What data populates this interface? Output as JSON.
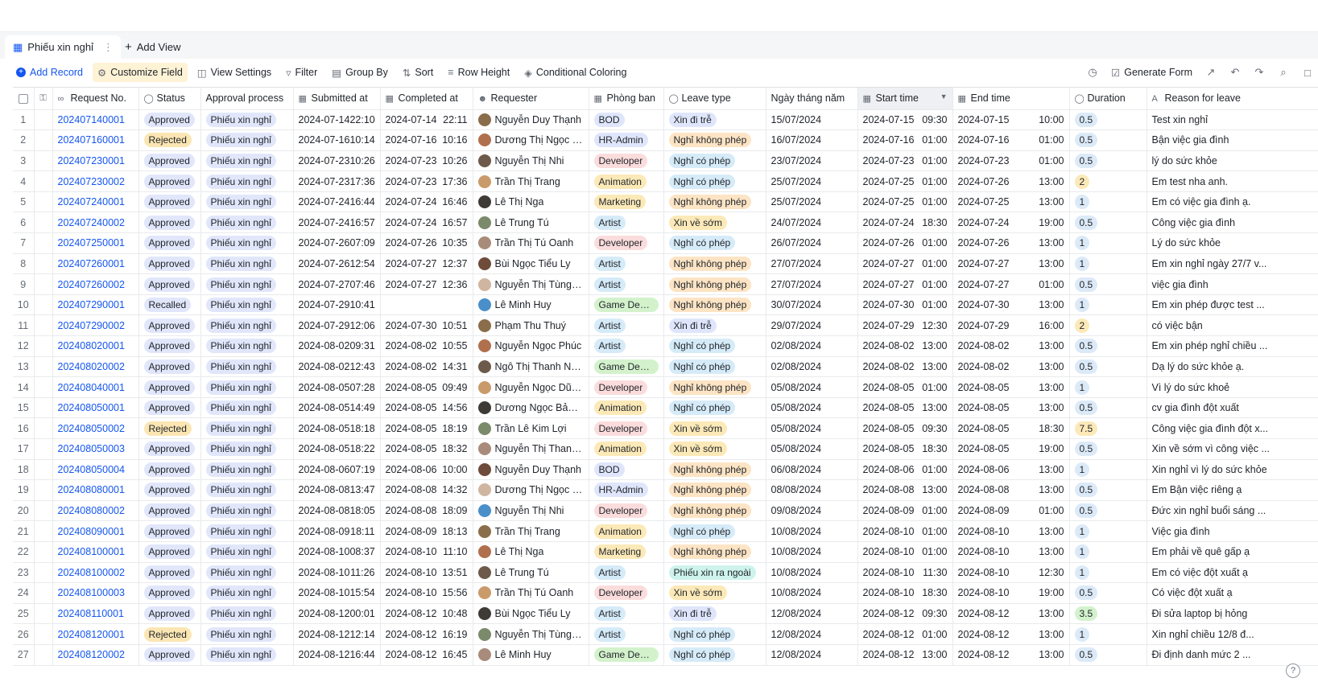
{
  "view": {
    "tab_label": "Phiếu xin nghỉ",
    "add_view_label": "Add View"
  },
  "toolbar": {
    "add_record": "Add Record",
    "customize_field": "Customize Field",
    "view_settings": "View Settings",
    "filter": "Filter",
    "group_by": "Group By",
    "sort": "Sort",
    "row_height": "Row Height",
    "conditional_coloring": "Conditional Coloring",
    "generate_form": "Generate Form"
  },
  "columns": [
    "Request No.",
    "Status",
    "Approval process",
    "Submitted at",
    "Completed at",
    "Requester",
    "Phòng ban",
    "Leave type",
    "Ngày tháng năm",
    "Start time",
    "End time",
    "Duration",
    "Reason for leave"
  ],
  "colors": {
    "accent": "#1456f0",
    "status": {
      "Approved": "#e1e6fa",
      "Rejected": "#fbe6b3",
      "Recalled": "#e1e6fa"
    },
    "dept": {
      "BOD": "#dfe6fb",
      "HR-Admin": "#dfe6fb",
      "Developer": "#fbdcdc",
      "Animation": "#fce9b8",
      "Marketing": "#fce9b8",
      "Artist": "#d6ebf8",
      "Game Desi...": "#d3f2cc"
    },
    "leave": {
      "Xin đi trễ": "#dfe6fb",
      "Nghỉ không phép": "#fce4c4",
      "Nghỉ có phép": "#d6ebf8",
      "Xin về sớm": "#fce9b8",
      "Phiếu xin ra ngoài": "#cdf3ec"
    },
    "duration": {
      "0.5": "#dceaf8",
      "1": "#dceaf8",
      "2": "#fce9b8",
      "7.5": "#fce9b8",
      "3.5": "#d3f2cc"
    }
  },
  "rows": [
    {
      "n": "1",
      "req": "202407140001",
      "status": "Approved",
      "process": "Phiếu xin nghỉ",
      "sub_d": "2024-07-14",
      "sub_t": "22:10",
      "com_d": "2024-07-14",
      "com_t": "22:11",
      "requester": "Nguyễn Duy Thạnh",
      "dept": "BOD",
      "leave": "Xin đi trễ",
      "date": "15/07/2024",
      "st_d": "2024-07-15",
      "st_t": "09:30",
      "en_d": "2024-07-15",
      "en_t": "10:00",
      "dur": "0.5",
      "reason": "Test xin nghỉ"
    },
    {
      "n": "2",
      "req": "202407160001",
      "status": "Rejected",
      "process": "Phiếu xin nghỉ",
      "sub_d": "2024-07-16",
      "sub_t": "10:14",
      "com_d": "2024-07-16",
      "com_t": "10:16",
      "requester": "Dương Thị Ngọc Mai",
      "dept": "HR-Admin",
      "leave": "Nghỉ không phép",
      "date": "16/07/2024",
      "st_d": "2024-07-16",
      "st_t": "01:00",
      "en_d": "2024-07-16",
      "en_t": "01:00",
      "dur": "0.5",
      "reason": "Bận việc gia đình"
    },
    {
      "n": "3",
      "req": "202407230001",
      "status": "Approved",
      "process": "Phiếu xin nghỉ",
      "sub_d": "2024-07-23",
      "sub_t": "10:26",
      "com_d": "2024-07-23",
      "com_t": "10:26",
      "requester": "Nguyễn Thị  Nhi",
      "dept": "Developer",
      "leave": "Nghỉ có phép",
      "date": "23/07/2024",
      "st_d": "2024-07-23",
      "st_t": "01:00",
      "en_d": "2024-07-23",
      "en_t": "01:00",
      "dur": "0.5",
      "reason": "lý do sức khỏe"
    },
    {
      "n": "4",
      "req": "202407230002",
      "status": "Approved",
      "process": "Phiếu xin nghỉ",
      "sub_d": "2024-07-23",
      "sub_t": "17:36",
      "com_d": "2024-07-23",
      "com_t": "17:36",
      "requester": "Trần Thị Trang",
      "dept": "Animation",
      "leave": "Nghỉ có phép",
      "date": "25/07/2024",
      "st_d": "2024-07-25",
      "st_t": "01:00",
      "en_d": "2024-07-26",
      "en_t": "13:00",
      "dur": "2",
      "reason": "Em test nha anh."
    },
    {
      "n": "5",
      "req": "202407240001",
      "status": "Approved",
      "process": "Phiếu xin nghỉ",
      "sub_d": "2024-07-24",
      "sub_t": "16:44",
      "com_d": "2024-07-24",
      "com_t": "16:46",
      "requester": "Lê Thị Nga",
      "dept": "Marketing",
      "leave": "Nghỉ không phép",
      "date": "25/07/2024",
      "st_d": "2024-07-25",
      "st_t": "01:00",
      "en_d": "2024-07-25",
      "en_t": "13:00",
      "dur": "1",
      "reason": "Em có việc gia đình ạ."
    },
    {
      "n": "6",
      "req": "202407240002",
      "status": "Approved",
      "process": "Phiếu xin nghỉ",
      "sub_d": "2024-07-24",
      "sub_t": "16:57",
      "com_d": "2024-07-24",
      "com_t": "16:57",
      "requester": "Lê Trung Tú",
      "dept": "Artist",
      "leave": "Xin về sớm",
      "date": "24/07/2024",
      "st_d": "2024-07-24",
      "st_t": "18:30",
      "en_d": "2024-07-24",
      "en_t": "19:00",
      "dur": "0.5",
      "reason": "Công việc gia đình"
    },
    {
      "n": "7",
      "req": "202407250001",
      "status": "Approved",
      "process": "Phiếu xin nghỉ",
      "sub_d": "2024-07-26",
      "sub_t": "07:09",
      "com_d": "2024-07-26",
      "com_t": "10:35",
      "requester": "Trần Thị Tú Oanh",
      "dept": "Developer",
      "leave": "Nghỉ có phép",
      "date": "26/07/2024",
      "st_d": "2024-07-26",
      "st_t": "01:00",
      "en_d": "2024-07-26",
      "en_t": "13:00",
      "dur": "1",
      "reason": "Lý do sức khỏe"
    },
    {
      "n": "8",
      "req": "202407260001",
      "status": "Approved",
      "process": "Phiếu xin nghỉ",
      "sub_d": "2024-07-26",
      "sub_t": "12:54",
      "com_d": "2024-07-27",
      "com_t": "12:37",
      "requester": "Bùi Ngọc Tiểu Ly",
      "dept": "Artist",
      "leave": "Nghỉ không phép",
      "date": "27/07/2024",
      "st_d": "2024-07-27",
      "st_t": "01:00",
      "en_d": "2024-07-27",
      "en_t": "13:00",
      "dur": "1",
      "reason": "Em xin nghỉ ngày 27/7 v..."
    },
    {
      "n": "9",
      "req": "202407260002",
      "status": "Approved",
      "process": "Phiếu xin nghỉ",
      "sub_d": "2024-07-27",
      "sub_t": "07:46",
      "com_d": "2024-07-27",
      "com_t": "12:36",
      "requester": "Nguyễn Thị Tùng Thi...",
      "dept": "Artist",
      "leave": "Nghỉ không phép",
      "date": "27/07/2024",
      "st_d": "2024-07-27",
      "st_t": "01:00",
      "en_d": "2024-07-27",
      "en_t": "01:00",
      "dur": "0.5",
      "reason": "việc gia đình"
    },
    {
      "n": "10",
      "req": "202407290001",
      "status": "Recalled",
      "process": "Phiếu xin nghỉ",
      "sub_d": "2024-07-29",
      "sub_t": "10:41",
      "com_d": "",
      "com_t": "",
      "requester": "Lê Minh Huy",
      "dept": "Game Desi...",
      "leave": "Nghỉ không phép",
      "date": "30/07/2024",
      "st_d": "2024-07-30",
      "st_t": "01:00",
      "en_d": "2024-07-30",
      "en_t": "13:00",
      "dur": "1",
      "reason": "Em xin phép được test ..."
    },
    {
      "n": "11",
      "req": "202407290002",
      "status": "Approved",
      "process": "Phiếu xin nghỉ",
      "sub_d": "2024-07-29",
      "sub_t": "12:06",
      "com_d": "2024-07-30",
      "com_t": "10:51",
      "requester": "Phạm Thu Thuý",
      "dept": "Artist",
      "leave": "Xin đi trễ",
      "date": "29/07/2024",
      "st_d": "2024-07-29",
      "st_t": "12:30",
      "en_d": "2024-07-29",
      "en_t": "16:00",
      "dur": "2",
      "reason": "có việc bận"
    },
    {
      "n": "12",
      "req": "202408020001",
      "status": "Approved",
      "process": "Phiếu xin nghỉ",
      "sub_d": "2024-08-02",
      "sub_t": "09:31",
      "com_d": "2024-08-02",
      "com_t": "10:55",
      "requester": "Nguyễn Ngọc Phúc",
      "dept": "Artist",
      "leave": "Nghỉ có phép",
      "date": "02/08/2024",
      "st_d": "2024-08-02",
      "st_t": "13:00",
      "en_d": "2024-08-02",
      "en_t": "13:00",
      "dur": "0.5",
      "reason": "Em xin phép nghỉ chiều ..."
    },
    {
      "n": "13",
      "req": "202408020002",
      "status": "Approved",
      "process": "Phiếu xin nghỉ",
      "sub_d": "2024-08-02",
      "sub_t": "12:43",
      "com_d": "2024-08-02",
      "com_t": "14:31",
      "requester": "Ngô Thị Thanh Ngân",
      "dept": "Game Desi...",
      "leave": "Nghỉ có phép",
      "date": "02/08/2024",
      "st_d": "2024-08-02",
      "st_t": "13:00",
      "en_d": "2024-08-02",
      "en_t": "13:00",
      "dur": "0.5",
      "reason": "Dạ lý do sức khỏe ạ."
    },
    {
      "n": "14",
      "req": "202408040001",
      "status": "Approved",
      "process": "Phiếu xin nghỉ",
      "sub_d": "2024-08-05",
      "sub_t": "07:28",
      "com_d": "2024-08-05",
      "com_t": "09:49",
      "requester": "Nguyễn Ngọc Dũng_...",
      "dept": "Developer",
      "leave": "Nghỉ không phép",
      "date": "05/08/2024",
      "st_d": "2024-08-05",
      "st_t": "01:00",
      "en_d": "2024-08-05",
      "en_t": "13:00",
      "dur": "1",
      "reason": "Vì lý do sức khoẻ"
    },
    {
      "n": "15",
      "req": "202408050001",
      "status": "Approved",
      "process": "Phiếu xin nghỉ",
      "sub_d": "2024-08-05",
      "sub_t": "14:49",
      "com_d": "2024-08-05",
      "com_t": "14:56",
      "requester": "Dương Ngọc Bảo Bảo",
      "dept": "Animation",
      "leave": "Nghỉ có phép",
      "date": "05/08/2024",
      "st_d": "2024-08-05",
      "st_t": "13:00",
      "en_d": "2024-08-05",
      "en_t": "13:00",
      "dur": "0.5",
      "reason": "cv gia đình đột xuất"
    },
    {
      "n": "16",
      "req": "202408050002",
      "status": "Rejected",
      "process": "Phiếu xin nghỉ",
      "sub_d": "2024-08-05",
      "sub_t": "18:18",
      "com_d": "2024-08-05",
      "com_t": "18:19",
      "requester": "Trần Lê Kim Lợi",
      "dept": "Developer",
      "leave": "Xin về sớm",
      "date": "05/08/2024",
      "st_d": "2024-08-05",
      "st_t": "09:30",
      "en_d": "2024-08-05",
      "en_t": "18:30",
      "dur": "7.5",
      "reason": "Công việc gia đình đột x..."
    },
    {
      "n": "17",
      "req": "202408050003",
      "status": "Approved",
      "process": "Phiếu xin nghỉ",
      "sub_d": "2024-08-05",
      "sub_t": "18:22",
      "com_d": "2024-08-05",
      "com_t": "18:32",
      "requester": "Nguyễn Thị Thanh Thu",
      "dept": "Animation",
      "leave": "Xin về sớm",
      "date": "05/08/2024",
      "st_d": "2024-08-05",
      "st_t": "18:30",
      "en_d": "2024-08-05",
      "en_t": "19:00",
      "dur": "0.5",
      "reason": "Xin về sớm vì công việc ..."
    },
    {
      "n": "18",
      "req": "202408050004",
      "status": "Approved",
      "process": "Phiếu xin nghỉ",
      "sub_d": "2024-08-06",
      "sub_t": "07:19",
      "com_d": "2024-08-06",
      "com_t": "10:00",
      "requester": "Nguyễn Duy Thạnh",
      "dept": "BOD",
      "leave": "Nghỉ không phép",
      "date": "06/08/2024",
      "st_d": "2024-08-06",
      "st_t": "01:00",
      "en_d": "2024-08-06",
      "en_t": "13:00",
      "dur": "1",
      "reason": "Xin nghỉ vì lý do sức khỏe"
    },
    {
      "n": "19",
      "req": "202408080001",
      "status": "Approved",
      "process": "Phiếu xin nghỉ",
      "sub_d": "2024-08-08",
      "sub_t": "13:47",
      "com_d": "2024-08-08",
      "com_t": "14:32",
      "requester": "Dương Thị Ngọc Mai",
      "dept": "HR-Admin",
      "leave": "Nghỉ không phép",
      "date": "08/08/2024",
      "st_d": "2024-08-08",
      "st_t": "13:00",
      "en_d": "2024-08-08",
      "en_t": "13:00",
      "dur": "0.5",
      "reason": "Em Bận việc riêng ạ"
    },
    {
      "n": "20",
      "req": "202408080002",
      "status": "Approved",
      "process": "Phiếu xin nghỉ",
      "sub_d": "2024-08-08",
      "sub_t": "18:05",
      "com_d": "2024-08-08",
      "com_t": "18:09",
      "requester": "Nguyễn Thị  Nhi",
      "dept": "Developer",
      "leave": "Nghỉ không phép",
      "date": "09/08/2024",
      "st_d": "2024-08-09",
      "st_t": "01:00",
      "en_d": "2024-08-09",
      "en_t": "01:00",
      "dur": "0.5",
      "reason": "Đức xin nghỉ buổi sáng ..."
    },
    {
      "n": "21",
      "req": "202408090001",
      "status": "Approved",
      "process": "Phiếu xin nghỉ",
      "sub_d": "2024-08-09",
      "sub_t": "18:11",
      "com_d": "2024-08-09",
      "com_t": "18:13",
      "requester": "Trần Thị Trang",
      "dept": "Animation",
      "leave": "Nghỉ có phép",
      "date": "10/08/2024",
      "st_d": "2024-08-10",
      "st_t": "01:00",
      "en_d": "2024-08-10",
      "en_t": "13:00",
      "dur": "1",
      "reason": "Việc gia đình"
    },
    {
      "n": "22",
      "req": "202408100001",
      "status": "Approved",
      "process": "Phiếu xin nghỉ",
      "sub_d": "2024-08-10",
      "sub_t": "08:37",
      "com_d": "2024-08-10",
      "com_t": "11:10",
      "requester": "Lê Thị Nga",
      "dept": "Marketing",
      "leave": "Nghỉ không phép",
      "date": "10/08/2024",
      "st_d": "2024-08-10",
      "st_t": "01:00",
      "en_d": "2024-08-10",
      "en_t": "13:00",
      "dur": "1",
      "reason": "Em phải về quê gấp ạ"
    },
    {
      "n": "23",
      "req": "202408100002",
      "status": "Approved",
      "process": "Phiếu xin nghỉ",
      "sub_d": "2024-08-10",
      "sub_t": "11:26",
      "com_d": "2024-08-10",
      "com_t": "13:51",
      "requester": "Lê Trung Tú",
      "dept": "Artist",
      "leave": "Phiếu xin ra ngoài",
      "date": "10/08/2024",
      "st_d": "2024-08-10",
      "st_t": "11:30",
      "en_d": "2024-08-10",
      "en_t": "12:30",
      "dur": "1",
      "reason": "Em có việc đột xuất ạ"
    },
    {
      "n": "24",
      "req": "202408100003",
      "status": "Approved",
      "process": "Phiếu xin nghỉ",
      "sub_d": "2024-08-10",
      "sub_t": "15:54",
      "com_d": "2024-08-10",
      "com_t": "15:56",
      "requester": "Trần Thị Tú Oanh",
      "dept": "Developer",
      "leave": "Xin về sớm",
      "date": "10/08/2024",
      "st_d": "2024-08-10",
      "st_t": "18:30",
      "en_d": "2024-08-10",
      "en_t": "19:00",
      "dur": "0.5",
      "reason": "Có việc đột xuất ạ"
    },
    {
      "n": "25",
      "req": "202408110001",
      "status": "Approved",
      "process": "Phiếu xin nghỉ",
      "sub_d": "2024-08-12",
      "sub_t": "00:01",
      "com_d": "2024-08-12",
      "com_t": "10:48",
      "requester": "Bùi Ngọc Tiểu Ly",
      "dept": "Artist",
      "leave": "Xin đi trễ",
      "date": "12/08/2024",
      "st_d": "2024-08-12",
      "st_t": "09:30",
      "en_d": "2024-08-12",
      "en_t": "13:00",
      "dur": "3.5",
      "reason": "Đi sửa laptop bị hỏng"
    },
    {
      "n": "26",
      "req": "202408120001",
      "status": "Rejected",
      "process": "Phiếu xin nghỉ",
      "sub_d": "2024-08-12",
      "sub_t": "12:14",
      "com_d": "2024-08-12",
      "com_t": "16:19",
      "requester": "Nguyễn Thị Tùng Thi...",
      "dept": "Artist",
      "leave": "Nghỉ có phép",
      "date": "12/08/2024",
      "st_d": "2024-08-12",
      "st_t": "01:00",
      "en_d": "2024-08-12",
      "en_t": "13:00",
      "dur": "1",
      "reason": "Xin nghỉ chiều 12/8 đ..."
    },
    {
      "n": "27",
      "req": "202408120002",
      "status": "Approved",
      "process": "Phiếu xin nghỉ",
      "sub_d": "2024-08-12",
      "sub_t": "16:44",
      "com_d": "2024-08-12",
      "com_t": "16:45",
      "requester": "Lê Minh Huy",
      "dept": "Game Desi...",
      "leave": "Nghỉ có phép",
      "date": "12/08/2024",
      "st_d": "2024-08-12",
      "st_t": "13:00",
      "en_d": "2024-08-12",
      "en_t": "13:00",
      "dur": "0.5",
      "reason": "Đi định danh mức 2 ..."
    }
  ]
}
